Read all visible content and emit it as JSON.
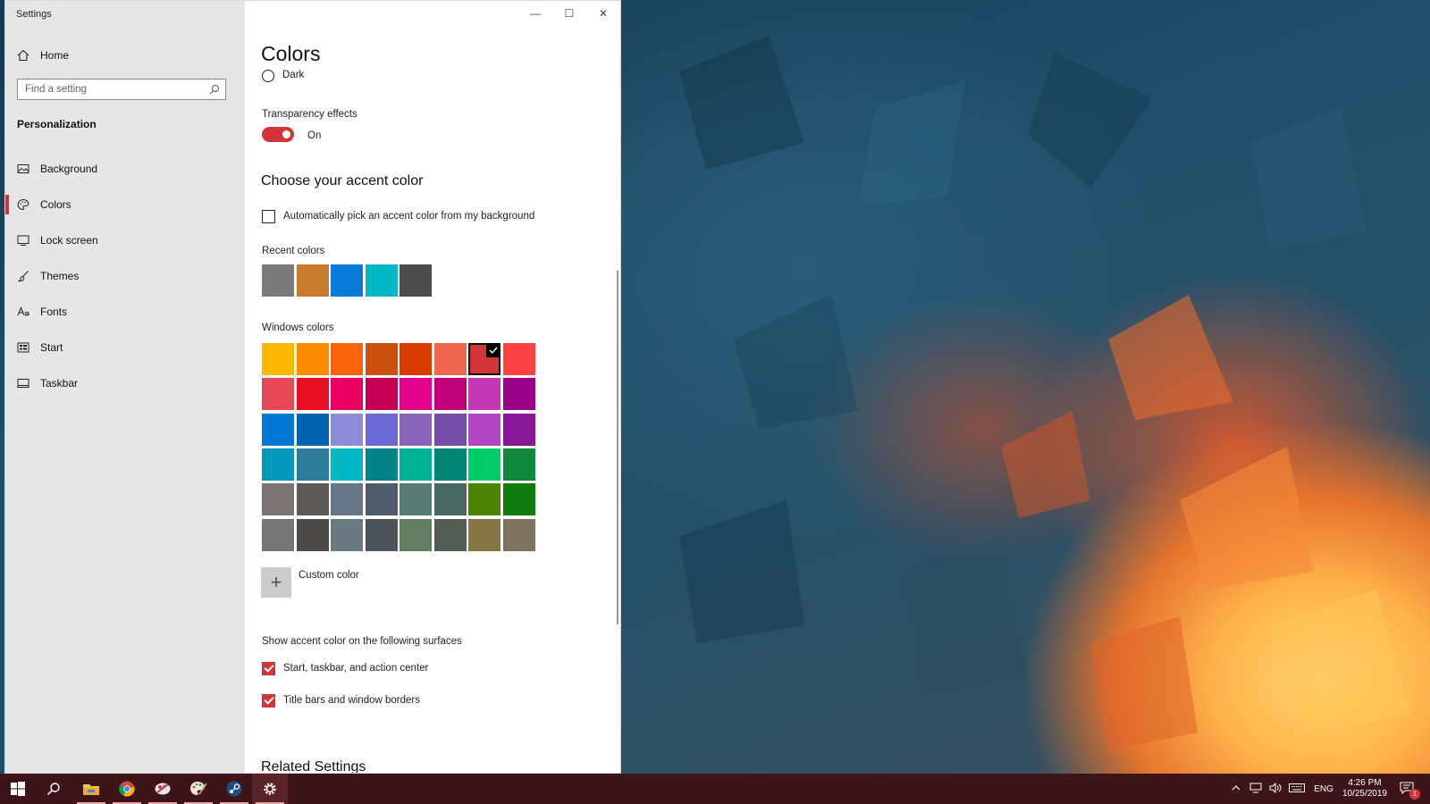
{
  "window": {
    "app_title": "Settings",
    "controls": {
      "minimize": "—",
      "maximize": "☐",
      "close": "✕"
    }
  },
  "sidebar": {
    "home_label": "Home",
    "search_placeholder": "Find a setting",
    "section_heading": "Personalization",
    "items": [
      {
        "label": "Background",
        "icon": "background-picture-icon"
      },
      {
        "label": "Colors",
        "icon": "palette-icon",
        "selected": true
      },
      {
        "label": "Lock screen",
        "icon": "lock-screen-icon"
      },
      {
        "label": "Themes",
        "icon": "themes-brush-icon"
      },
      {
        "label": "Fonts",
        "icon": "fonts-icon"
      },
      {
        "label": "Start",
        "icon": "start-menu-icon"
      },
      {
        "label": "Taskbar",
        "icon": "taskbar-icon"
      }
    ]
  },
  "content": {
    "page_title": "Colors",
    "app_mode_option_dark": "Dark",
    "transparency": {
      "label": "Transparency effects",
      "state": "On",
      "enabled": true
    },
    "accent_heading": "Choose your accent color",
    "auto_pick_label": "Automatically pick an accent color from my background",
    "auto_pick_checked": false,
    "recent_colors_label": "Recent colors",
    "recent_colors": [
      "#7a7a7a",
      "#ca7a2e",
      "#0a78d7",
      "#00b7c3",
      "#4c4c4c"
    ],
    "windows_colors_label": "Windows colors",
    "windows_colors": [
      [
        "#ffb900",
        "#ff8c00",
        "#f7630c",
        "#ca5010",
        "#da3b01",
        "#ef6950",
        "#d13438",
        "#ff4343"
      ],
      [
        "#e74856",
        "#e81123",
        "#ea005e",
        "#c30052",
        "#e3008c",
        "#bf0077",
        "#c239b3",
        "#9a0089"
      ],
      [
        "#0078d7",
        "#0063b1",
        "#8e8cd8",
        "#6b69d6",
        "#8764b8",
        "#744da9",
        "#b146c2",
        "#881798"
      ],
      [
        "#0099bc",
        "#2d7d9a",
        "#00b7c3",
        "#038387",
        "#00b294",
        "#018574",
        "#00cc6a",
        "#10893e"
      ],
      [
        "#7a7574",
        "#5d5a58",
        "#68768a",
        "#515c6b",
        "#567c73",
        "#486860",
        "#498205",
        "#107c10"
      ],
      [
        "#767676",
        "#4c4a48",
        "#69797e",
        "#4a5459",
        "#647c64",
        "#525e54",
        "#847545",
        "#7e735f"
      ]
    ],
    "selected_color": "#d13438",
    "custom_color_label": "Custom color",
    "surfaces_label": "Show accent color on the following surfaces",
    "surface_start_label": "Start, taskbar, and action center",
    "surface_start_checked": true,
    "surface_titlebars_label": "Title bars and window borders",
    "surface_titlebars_checked": true,
    "related_settings_heading": "Related Settings"
  },
  "taskbar": {
    "apps": [
      "start-windows-icon",
      "search-icon",
      "file-explorer-icon",
      "chrome-icon",
      "paint-3d-icon",
      "paint-palette-icon",
      "steam-icon",
      "settings-gear-icon"
    ],
    "language": "ENG",
    "time": "4:26 PM",
    "date": "10/25/2019",
    "notification_count": "1"
  },
  "colors": {
    "accent": "#d13438",
    "taskbar": "#3d1418"
  }
}
